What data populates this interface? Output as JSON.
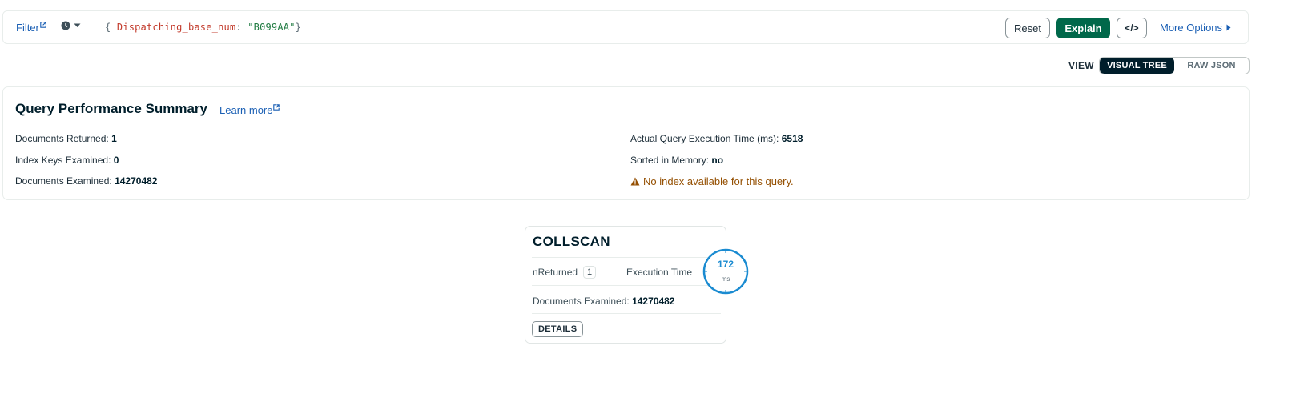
{
  "filter_bar": {
    "filter_label": "Filter",
    "query": {
      "open": "{ ",
      "key": "Dispatching_base_num",
      "sep": ": ",
      "value": "\"B099AA\"",
      "close": "}"
    },
    "reset_label": "Reset",
    "explain_label": "Explain",
    "code_label": "</>",
    "more_options_label": "More Options"
  },
  "view": {
    "label": "VIEW",
    "options": [
      "VISUAL TREE",
      "RAW JSON"
    ],
    "selected": "VISUAL TREE"
  },
  "summary": {
    "title": "Query Performance Summary",
    "learn_more": "Learn more",
    "docs_returned_label": "Documents Returned:",
    "docs_returned_value": "1",
    "index_keys_label": "Index Keys Examined:",
    "index_keys_value": "0",
    "docs_examined_label": "Documents Examined:",
    "docs_examined_value": "14270482",
    "exec_time_label": "Actual Query Execution Time (ms):",
    "exec_time_value": "6518",
    "sorted_label": "Sorted in Memory:",
    "sorted_value": "no",
    "warning": "No index available for this query."
  },
  "stage": {
    "name": "COLLSCAN",
    "nreturned_label": "nReturned",
    "nreturned_value": "1",
    "exec_time_label": "Execution Time",
    "exec_time_value": "172",
    "exec_time_unit": "ms",
    "docs_examined_label": "Documents Examined:",
    "docs_examined_value": "14270482",
    "details_label": "DETAILS"
  },
  "colors": {
    "primary_green": "#00684a",
    "link_blue": "#1a5fb4",
    "warning_brown": "#944f01",
    "timer_blue": "#1a8bd1",
    "dark": "#001e2b"
  },
  "icons": [
    "external-link-icon",
    "clock-icon",
    "chevron-down-icon",
    "caret-right-icon",
    "warning-icon"
  ]
}
